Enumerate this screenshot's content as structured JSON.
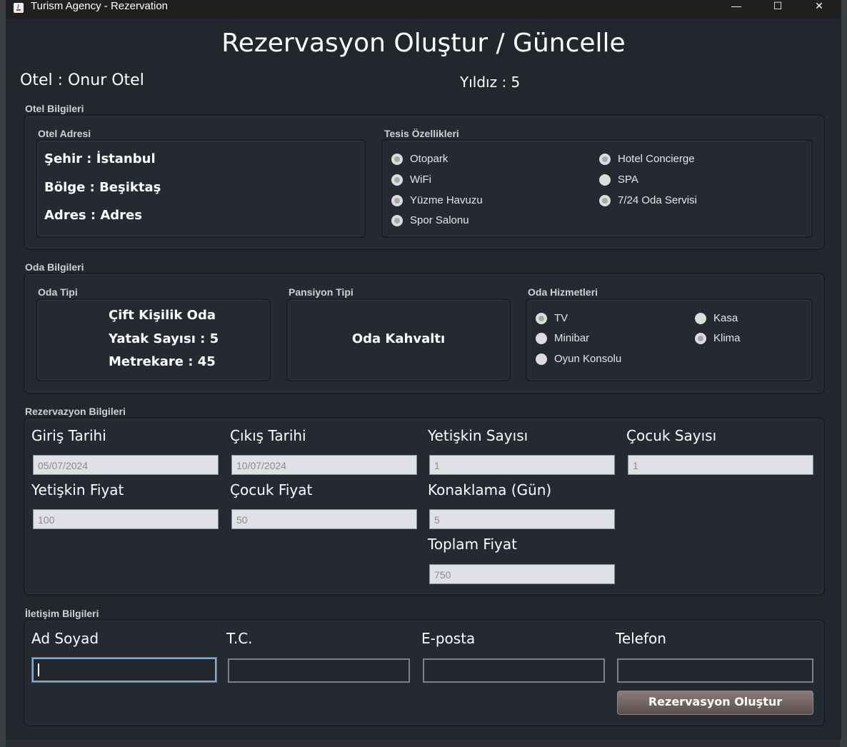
{
  "window": {
    "title": "Turism Agency - Rezervation",
    "minimize": "—",
    "maximize": "☐",
    "close": "✕"
  },
  "page_title": "Rezervasyon Oluştur / Güncelle",
  "hotel": {
    "name_label": "Otel : Onur Otel",
    "star_label": "Yıldız : 5"
  },
  "hotel_info": {
    "group_label": "Otel Bilgileri",
    "address": {
      "group_label": "Otel Adresi",
      "city": "Şehir : İstanbul",
      "region": "Bölge : Beşiktaş",
      "address": "Adres : Adres"
    },
    "facilities": {
      "group_label": "Tesis Özellikleri",
      "items": [
        {
          "label": "Otopark",
          "selected": true
        },
        {
          "label": "WiFi",
          "selected": true
        },
        {
          "label": "Yüzme Havuzu",
          "selected": true
        },
        {
          "label": "Spor Salonu",
          "selected": true
        },
        {
          "label": "Hotel Concierge",
          "selected": true
        },
        {
          "label": "SPA",
          "selected": false
        },
        {
          "label": "7/24 Oda Servisi",
          "selected": true
        }
      ]
    }
  },
  "room_info": {
    "group_label": "Oda Bilgileri",
    "room_type": {
      "group_label": "Oda Tipi",
      "type": "Çift Kişilik Oda",
      "beds": "Yatak Sayısı : 5",
      "area": "Metrekare : 45"
    },
    "board_type": {
      "group_label": "Pansiyon Tipi",
      "value": "Oda Kahvaltı"
    },
    "services": {
      "group_label": "Oda Hizmetleri",
      "items": [
        {
          "label": "TV",
          "selected": true
        },
        {
          "label": "Minibar",
          "selected": false
        },
        {
          "label": "Oyun Konsolu",
          "selected": false
        },
        {
          "label": "Kasa",
          "selected": false
        },
        {
          "label": "Klima",
          "selected": true
        }
      ]
    }
  },
  "reservation_info": {
    "group_label": "Rezervazyon Bilgileri",
    "checkin": {
      "label": "Giriş Tarihi",
      "value": "05/07/2024"
    },
    "checkout": {
      "label": "Çıkış Tarihi",
      "value": "10/07/2024"
    },
    "adults": {
      "label": "Yetişkin Sayısı",
      "value": "1"
    },
    "children": {
      "label": "Çocuk Sayısı",
      "value": "1"
    },
    "adult_price": {
      "label": "Yetişkin Fiyat",
      "value": "100"
    },
    "child_price": {
      "label": "Çocuk Fiyat",
      "value": "50"
    },
    "nights": {
      "label": "Konaklama (Gün)",
      "value": "5"
    },
    "total": {
      "label": "Toplam Fiyat",
      "value": "750"
    }
  },
  "contact_info": {
    "group_label": "İletişim Bilgileri",
    "name": {
      "label": "Ad Soyad",
      "value": ""
    },
    "tc": {
      "label": "T.C.",
      "value": ""
    },
    "email": {
      "label": "E-posta",
      "value": ""
    },
    "phone": {
      "label": "Telefon",
      "value": ""
    },
    "submit_label": "Rezervasyon Oluştur"
  },
  "colors": {
    "background": "#22262d",
    "panel": "#252932",
    "button": "#6f6260"
  }
}
